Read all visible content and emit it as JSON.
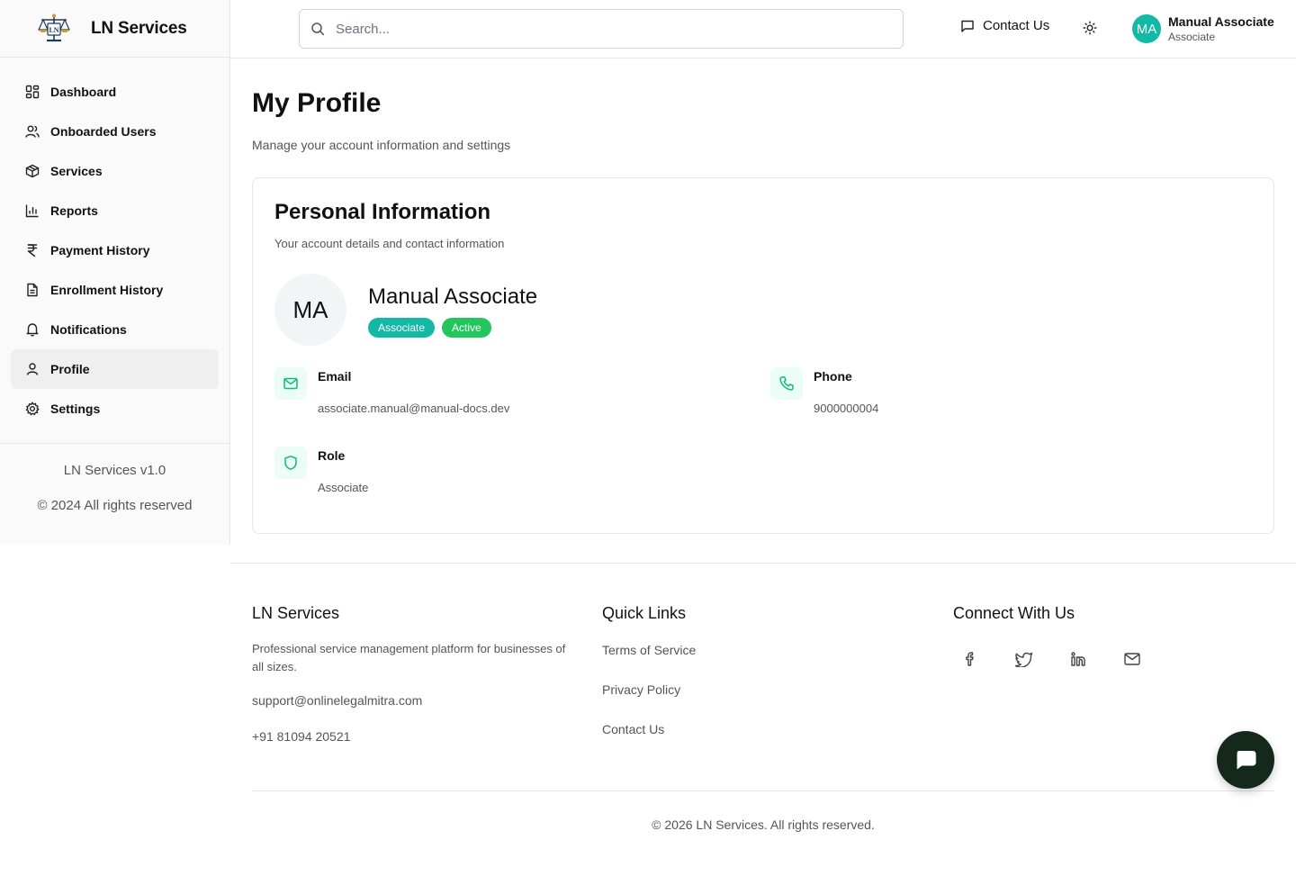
{
  "brand": {
    "name": "LN Services",
    "logo_icon": "scales-of-justice-logo-icon",
    "logo_text": "LN"
  },
  "sidebar": {
    "items": [
      {
        "label": "Dashboard",
        "icon": "grid-icon"
      },
      {
        "label": "Onboarded Users",
        "icon": "users-icon"
      },
      {
        "label": "Services",
        "icon": "package-icon"
      },
      {
        "label": "Reports",
        "icon": "bar-chart-icon"
      },
      {
        "label": "Payment History",
        "icon": "rupee-icon"
      },
      {
        "label": "Enrollment History",
        "icon": "file-text-icon"
      },
      {
        "label": "Notifications",
        "icon": "bell-icon"
      },
      {
        "label": "Profile",
        "icon": "user-icon",
        "active": true
      },
      {
        "label": "Settings",
        "icon": "gear-icon"
      }
    ],
    "version": "LN Services v1.0",
    "copyright": "© 2024 All rights reserved"
  },
  "header": {
    "search_placeholder": "Search...",
    "contact_label": "Contact Us",
    "theme_icon": "sun-icon",
    "user": {
      "initials": "MA",
      "name": "Manual Associate",
      "role": "Associate"
    }
  },
  "page": {
    "title": "My Profile",
    "subtitle": "Manage your account information and settings"
  },
  "profile_card": {
    "title": "Personal Information",
    "subtitle": "Your account details and contact information",
    "initials": "MA",
    "name": "Manual Associate",
    "badges": [
      "Associate",
      "Active"
    ],
    "fields": {
      "email": {
        "label": "Email",
        "value": "associate.manual@manual-docs.dev",
        "icon": "mail-icon"
      },
      "phone": {
        "label": "Phone",
        "value": "9000000004",
        "icon": "phone-icon"
      },
      "role": {
        "label": "Role",
        "value": "Associate",
        "icon": "shield-icon"
      }
    }
  },
  "footer": {
    "about": {
      "title": "LN Services",
      "description": "Professional service management platform for businesses of all sizes.",
      "email": "support@onlinelegalmitra.com",
      "phone": "+91 81094 20521"
    },
    "quick_links": {
      "title": "Quick Links",
      "links": [
        "Terms of Service",
        "Privacy Policy",
        "Contact Us"
      ]
    },
    "connect": {
      "title": "Connect With Us",
      "icons": [
        "facebook-icon",
        "twitter-icon",
        "linkedin-icon",
        "mail-icon"
      ]
    },
    "copyright": "© 2026 LN Services. All rights reserved."
  },
  "colors": {
    "accent": "#14b8a6",
    "active_badge": "#22c55e",
    "chat_fab": "#14291c",
    "icon_green": "#10b981"
  },
  "chat": {
    "icon": "chat-bubble-icon"
  }
}
